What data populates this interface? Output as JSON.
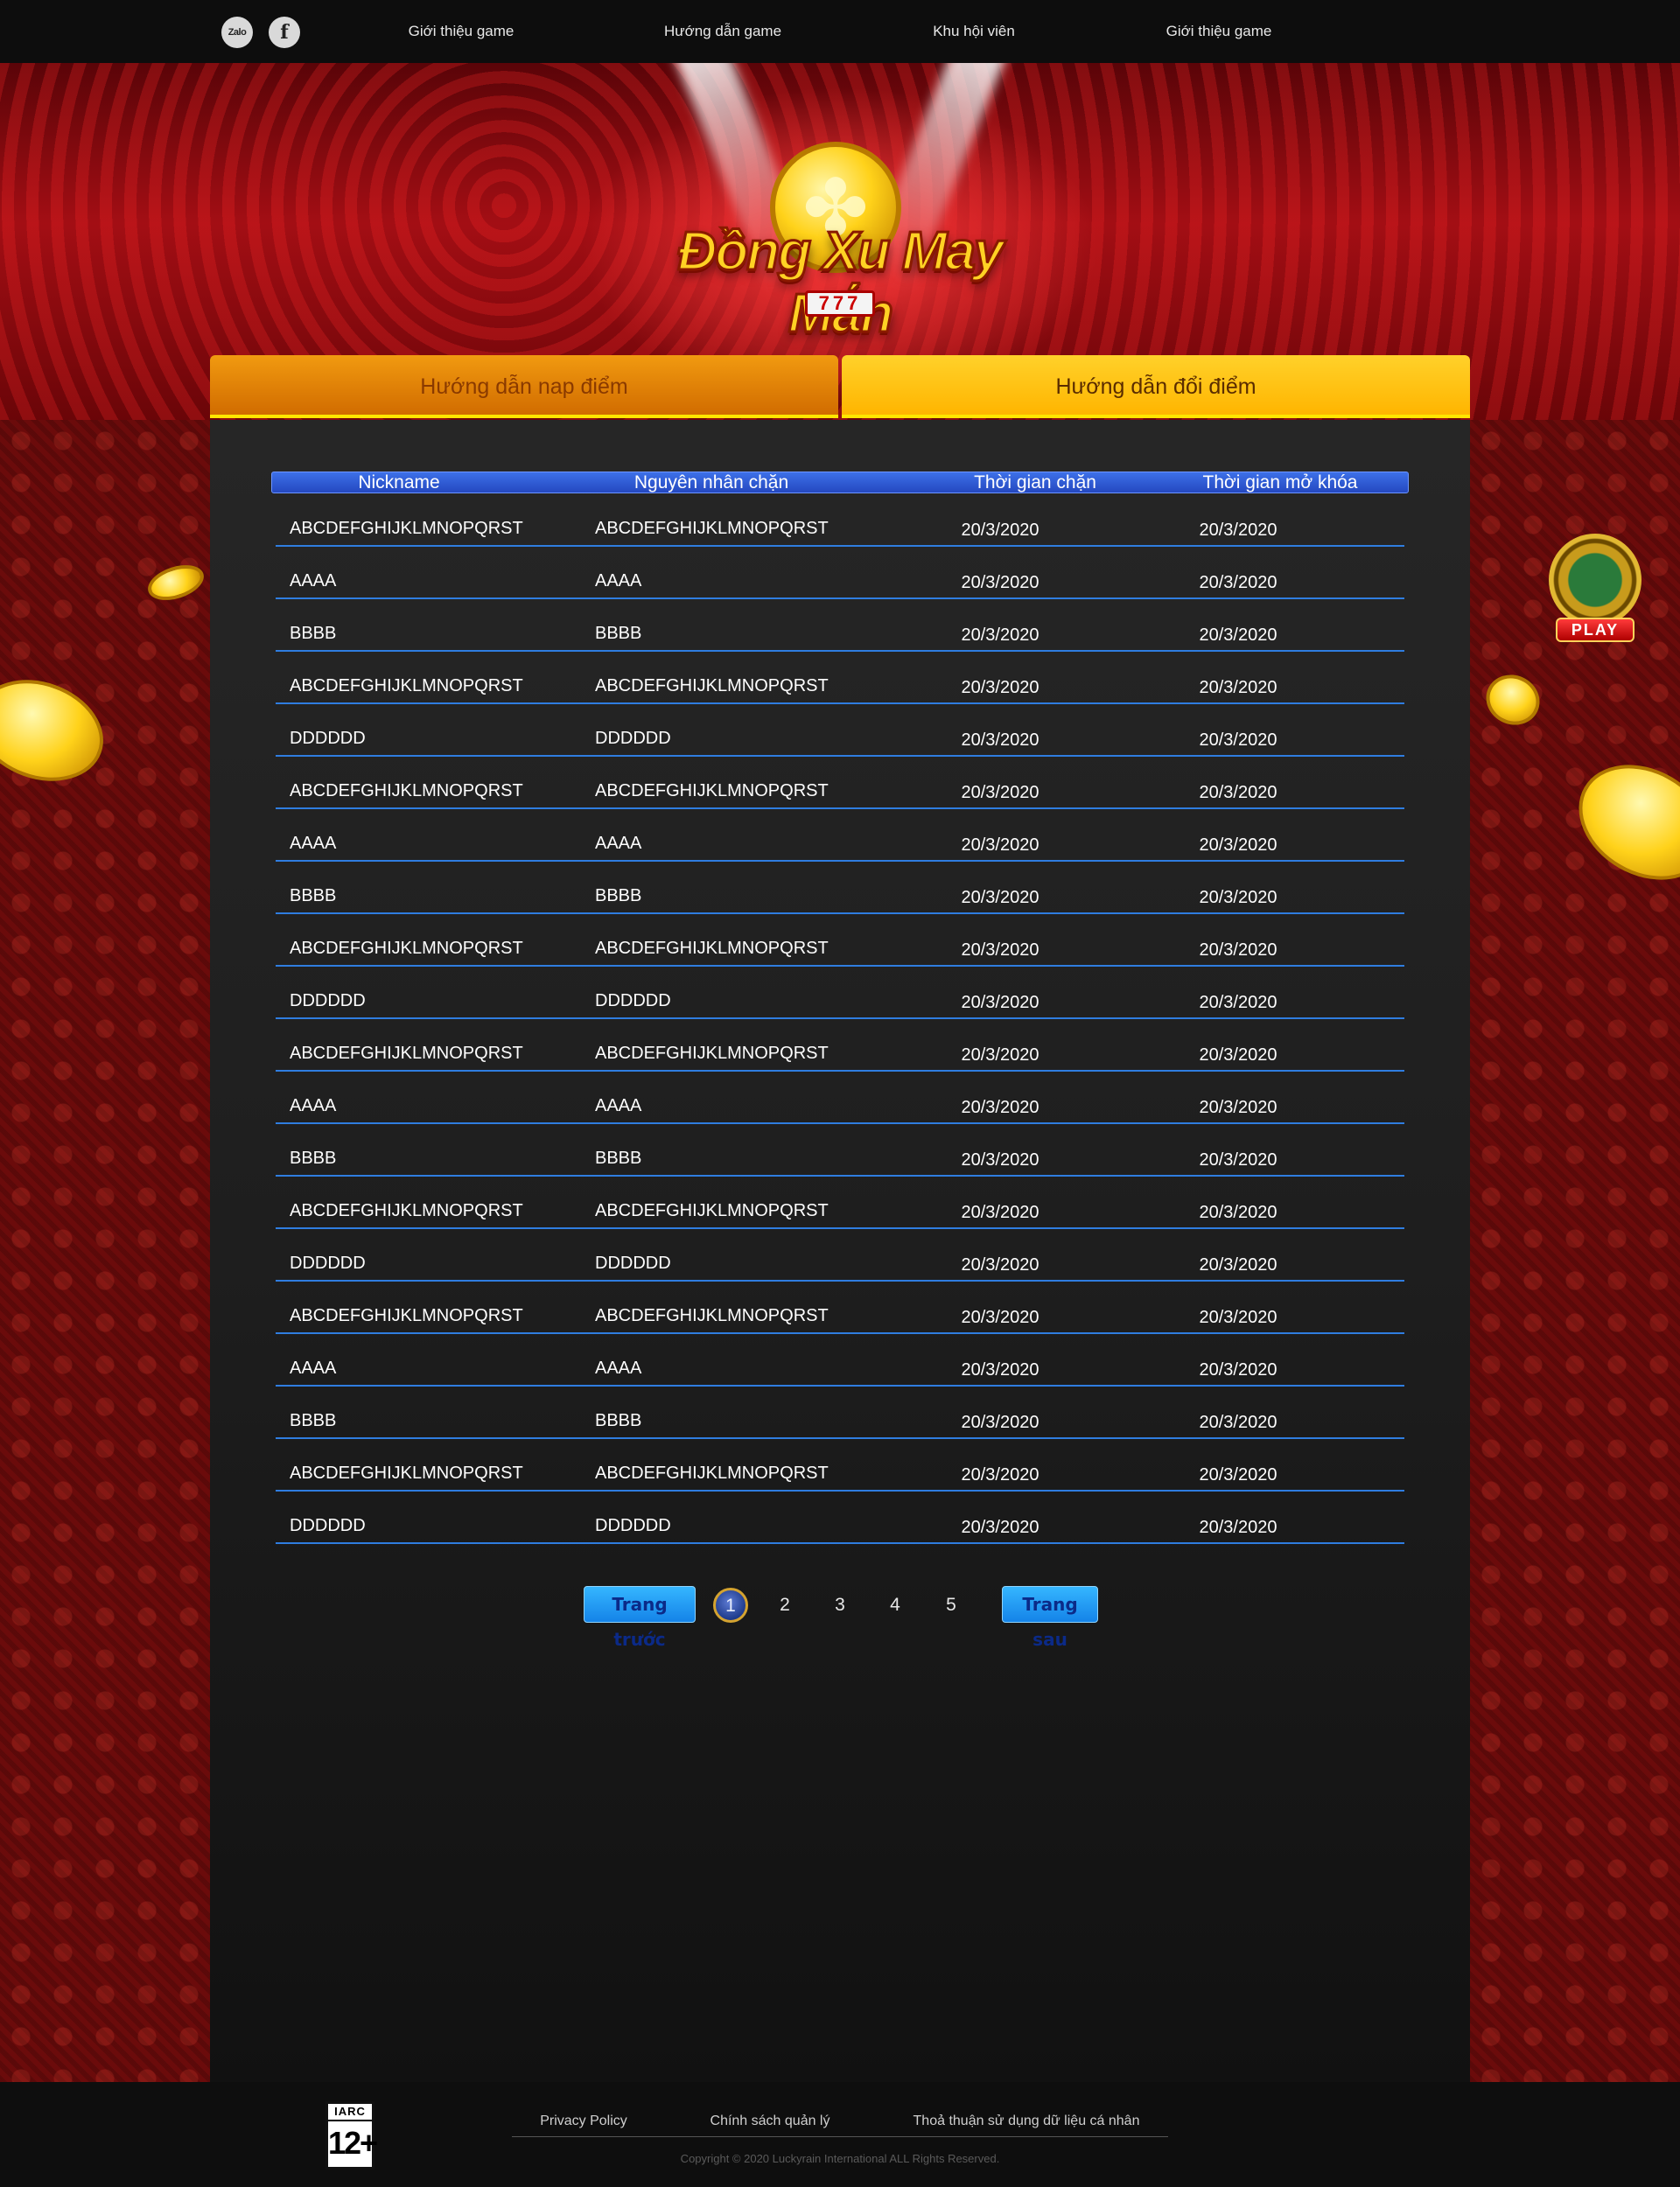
{
  "nav": {
    "social": [
      {
        "name": "zalo-icon",
        "label": "Zalo"
      },
      {
        "name": "facebook-icon",
        "label": "f"
      }
    ],
    "links": [
      "Giới thiệu game",
      "Hướng dẫn game",
      "Khu hội viên",
      "Giới thiệu game"
    ]
  },
  "hero": {
    "logo_text": "Đồng Xu May Mắn",
    "logo_sub": "777"
  },
  "tabs": [
    {
      "label": "Hướng dẫn nap điểm",
      "active": false
    },
    {
      "label": "Hướng dẫn đổi điểm",
      "active": true
    }
  ],
  "table": {
    "headers": [
      "Nickname",
      "Nguyên nhân chặn",
      "Thời gian chặn",
      "Thời gian mở khóa"
    ],
    "rows": [
      [
        "ABCDEFGHIJKLMNOPQRST",
        "ABCDEFGHIJKLMNOPQRST",
        "20/3/2020",
        "20/3/2020"
      ],
      [
        "AAAA",
        "AAAA",
        "20/3/2020",
        "20/3/2020"
      ],
      [
        "BBBB",
        "BBBB",
        "20/3/2020",
        "20/3/2020"
      ],
      [
        "ABCDEFGHIJKLMNOPQRST",
        "ABCDEFGHIJKLMNOPQRST",
        "20/3/2020",
        "20/3/2020"
      ],
      [
        "DDDDDD",
        "DDDDDD",
        "20/3/2020",
        "20/3/2020"
      ],
      [
        "ABCDEFGHIJKLMNOPQRST",
        "ABCDEFGHIJKLMNOPQRST",
        "20/3/2020",
        "20/3/2020"
      ],
      [
        "AAAA",
        "AAAA",
        "20/3/2020",
        "20/3/2020"
      ],
      [
        "BBBB",
        "BBBB",
        "20/3/2020",
        "20/3/2020"
      ],
      [
        "ABCDEFGHIJKLMNOPQRST",
        "ABCDEFGHIJKLMNOPQRST",
        "20/3/2020",
        "20/3/2020"
      ],
      [
        "DDDDDD",
        "DDDDDD",
        "20/3/2020",
        "20/3/2020"
      ],
      [
        "ABCDEFGHIJKLMNOPQRST",
        "ABCDEFGHIJKLMNOPQRST",
        "20/3/2020",
        "20/3/2020"
      ],
      [
        "AAAA",
        "AAAA",
        "20/3/2020",
        "20/3/2020"
      ],
      [
        "BBBB",
        "BBBB",
        "20/3/2020",
        "20/3/2020"
      ],
      [
        "ABCDEFGHIJKLMNOPQRST",
        "ABCDEFGHIJKLMNOPQRST",
        "20/3/2020",
        "20/3/2020"
      ],
      [
        "DDDDDD",
        "DDDDDD",
        "20/3/2020",
        "20/3/2020"
      ],
      [
        "ABCDEFGHIJKLMNOPQRST",
        "ABCDEFGHIJKLMNOPQRST",
        "20/3/2020",
        "20/3/2020"
      ],
      [
        "AAAA",
        "AAAA",
        "20/3/2020",
        "20/3/2020"
      ],
      [
        "BBBB",
        "BBBB",
        "20/3/2020",
        "20/3/2020"
      ],
      [
        "ABCDEFGHIJKLMNOPQRST",
        "ABCDEFGHIJKLMNOPQRST",
        "20/3/2020",
        "20/3/2020"
      ],
      [
        "DDDDDD",
        "DDDDDD",
        "20/3/2020",
        "20/3/2020"
      ]
    ]
  },
  "pagination": {
    "prev_label": "Trang trước",
    "next_label": "Trang sau",
    "pages": [
      "1",
      "2",
      "3",
      "4",
      "5"
    ],
    "current": "1"
  },
  "play_badge": {
    "label": "PLAY",
    "icon": "play-badge-icon"
  },
  "footer": {
    "rating_title": "IARC",
    "rating_age": "12+",
    "links": [
      "Privacy Policy",
      "Chính sách quản lý",
      "Thoả thuận sử dụng dữ liệu cá nhân"
    ],
    "copyright": "Copyright © 2020 Luckyrain International  ALL Rights Reserved."
  },
  "colors": {
    "tab_active": "#ffc20a",
    "tab_inactive": "#e88400",
    "table_header": "#2f5bd8",
    "row_divider": "#2f7de0",
    "pager_button": "#1f9af2"
  }
}
